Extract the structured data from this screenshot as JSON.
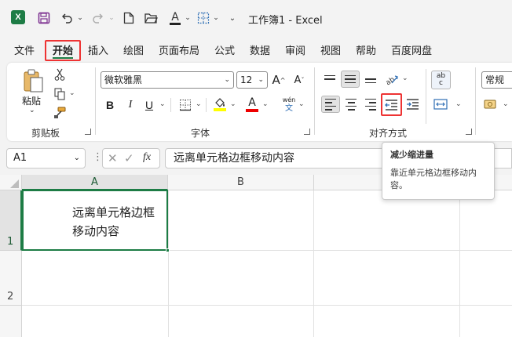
{
  "window": {
    "app_icon": "excel-icon",
    "title": "工作簿1  -  Excel"
  },
  "quick_access": {
    "icons": [
      "save-icon",
      "undo-icon",
      "redo-icon",
      "new-file-icon",
      "open-folder-icon",
      "font-color-icon",
      "borders-icon",
      "customize-icon"
    ]
  },
  "menu": {
    "items": [
      "文件",
      "开始",
      "插入",
      "绘图",
      "页面布局",
      "公式",
      "数据",
      "审阅",
      "视图",
      "帮助",
      "百度网盘"
    ],
    "active": "开始"
  },
  "ribbon": {
    "clipboard": {
      "label": "剪贴板",
      "paste_label": "粘贴"
    },
    "font": {
      "label": "字体",
      "font_name": "微软雅黑",
      "font_size": "12",
      "bold": "B",
      "italic": "I",
      "underline": "U",
      "phonetic_top": "wén",
      "phonetic_bottom": "文"
    },
    "alignment": {
      "label": "对齐方式",
      "wrap_text": "ab c"
    },
    "number": {
      "format": "常规"
    }
  },
  "formula_bar": {
    "name_box": "A1",
    "fx_label": "fx",
    "content": "远离单元格边框移动内容"
  },
  "sheet": {
    "columns": [
      "A",
      "B"
    ],
    "rows": [
      "1",
      "2"
    ],
    "cell_a1_line1": "远离单元格边框",
    "cell_a1_line2": "移动内容"
  },
  "tooltip": {
    "title": "减少缩进量",
    "body": "靠近单元格边框移动内容。"
  },
  "colors": {
    "accent": "#1d7c45",
    "highlight_box": "#e33333"
  }
}
